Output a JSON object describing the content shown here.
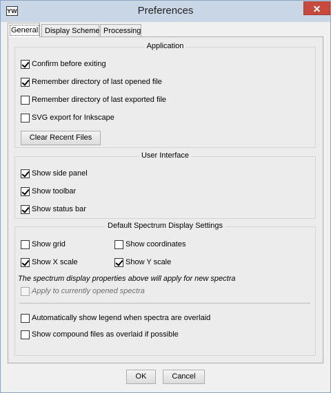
{
  "window": {
    "title": "Preferences",
    "app_icon_text": "YW",
    "close_label": "✕"
  },
  "tabs": [
    {
      "label": "General",
      "active": true
    },
    {
      "label": "Display Scheme",
      "active": false
    },
    {
      "label": "Processing",
      "active": false
    }
  ],
  "application": {
    "title": "Application",
    "options": [
      {
        "label": "Confirm before exiting",
        "checked": true
      },
      {
        "label": "Remember directory of last opened file",
        "checked": true
      },
      {
        "label": "Remember directory of last exported file",
        "checked": false
      },
      {
        "label": "SVG export for Inkscape",
        "checked": false
      }
    ],
    "clear_button": "Clear Recent Files"
  },
  "user_interface": {
    "title": "User Interface",
    "options": [
      {
        "label": "Show side panel",
        "checked": true
      },
      {
        "label": "Show toolbar",
        "checked": true
      },
      {
        "label": "Show status bar",
        "checked": true
      }
    ]
  },
  "spectrum": {
    "title": "Default Spectrum Display Settings",
    "show_grid": {
      "label": "Show grid",
      "checked": false
    },
    "show_coordinates": {
      "label": "Show coordinates",
      "checked": false
    },
    "show_x_scale": {
      "label": "Show X scale",
      "checked": true
    },
    "show_y_scale": {
      "label": "Show Y scale",
      "checked": true
    },
    "note": "The spectrum display properties above will apply for new spectra",
    "apply_current": {
      "label": "Apply to currently opened spectra",
      "checked": false,
      "disabled": true
    },
    "auto_legend": {
      "label": "Automatically show legend when spectra are overlaid",
      "checked": false
    },
    "compound_overlaid": {
      "label": "Show compound files as overlaid if possible",
      "checked": false
    }
  },
  "footer": {
    "ok": "OK",
    "cancel": "Cancel"
  }
}
